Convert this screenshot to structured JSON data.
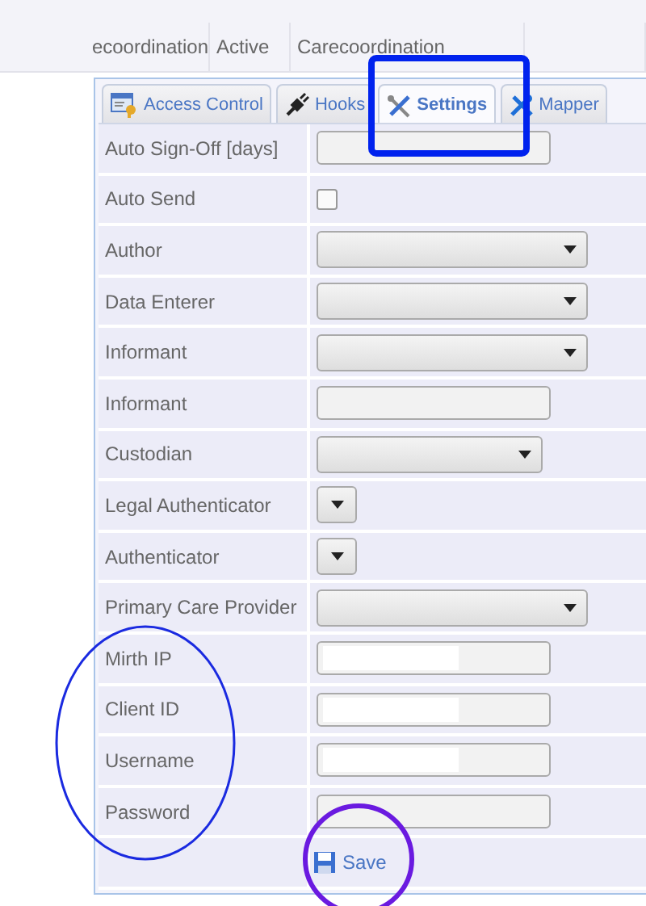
{
  "table": {
    "rows": [
      {
        "cells": [
          "ecoordination",
          "Active",
          "Carecoordination"
        ]
      }
    ]
  },
  "tabs": [
    {
      "label": "Access Control",
      "selected": false
    },
    {
      "label": "Hooks",
      "selected": false
    },
    {
      "label": "Settings",
      "selected": true
    },
    {
      "label": "Mapper",
      "selected": false
    }
  ],
  "fields": [
    {
      "label": "Auto Sign-Off [days]",
      "kind": "text"
    },
    {
      "label": "Auto Send",
      "kind": "checkbox",
      "checked": false
    },
    {
      "label": "Author",
      "kind": "select"
    },
    {
      "label": "Data Enterer",
      "kind": "select"
    },
    {
      "label": "Informant",
      "kind": "select"
    },
    {
      "label": "Informant",
      "kind": "text"
    },
    {
      "label": "Custodian",
      "kind": "select-medium"
    },
    {
      "label": "Legal Authenticator",
      "kind": "select-small"
    },
    {
      "label": "Authenticator",
      "kind": "select-small"
    },
    {
      "label": "Primary Care Provider",
      "kind": "select"
    },
    {
      "label": "Mirth IP",
      "kind": "text",
      "redacted": true
    },
    {
      "label": "Client ID",
      "kind": "text",
      "redacted": true
    },
    {
      "label": "Username",
      "kind": "text",
      "redacted": true
    },
    {
      "label": "Password",
      "kind": "text"
    }
  ],
  "save_button": "Save",
  "annotations": [
    {
      "kind": "rectangle",
      "color": "#0022ee"
    },
    {
      "kind": "ellipse",
      "color": "#1a2ae0"
    },
    {
      "kind": "circle",
      "color": "#6a1ae0"
    }
  ]
}
